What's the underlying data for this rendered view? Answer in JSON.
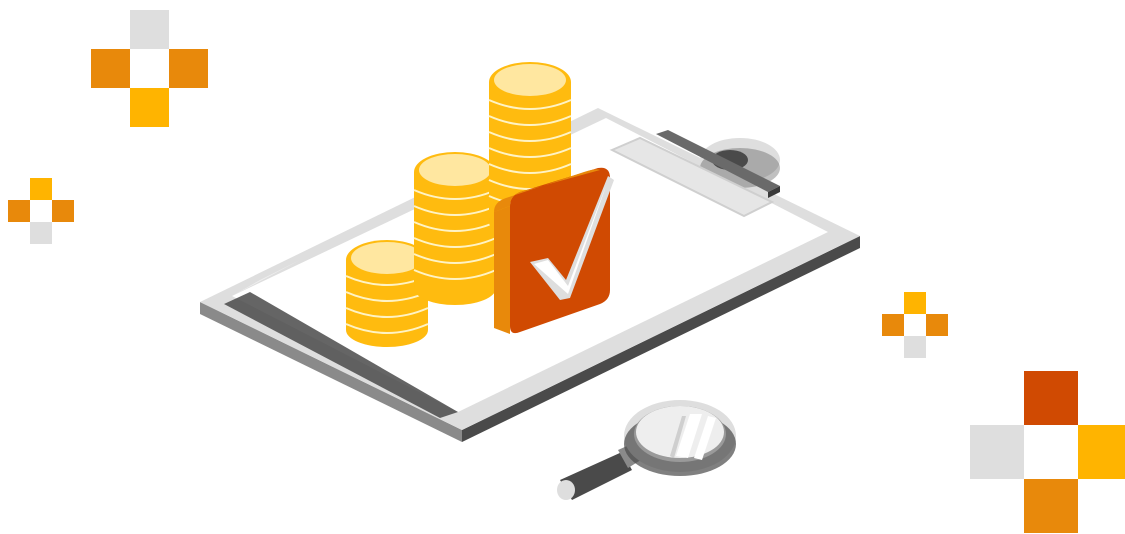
{
  "illustration": {
    "subject": "clipboard-with-coins-and-checkmark",
    "elements": [
      "clipboard",
      "coin-stacks",
      "checkmark-badge",
      "magnifying-glass",
      "pixel-crosses"
    ],
    "colors": {
      "orange": "#e8890b",
      "yellow": "#ffb400",
      "red_orange": "#d04a02",
      "light_gray": "#dedede",
      "dark_gray": "#4a4a4a",
      "mid_gray": "#9a9a9a",
      "paper": "#ffffff",
      "coin_face": "#ffe7a0",
      "coin_edge": "#ffbb0f"
    }
  }
}
